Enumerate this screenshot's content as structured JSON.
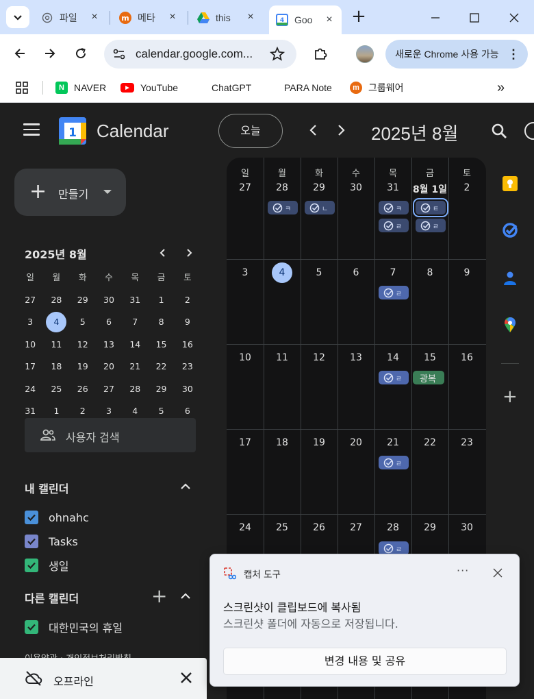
{
  "browser": {
    "tabs": [
      {
        "title": "파일",
        "icon": "chatgpt-icon"
      },
      {
        "title": "메타",
        "icon": "m-app-icon"
      },
      {
        "title": "this",
        "icon": "google-drive-icon"
      },
      {
        "title": "Goo",
        "icon": "google-calendar-icon",
        "active": true
      }
    ],
    "url": "calendar.google.com...",
    "update_label": "새로운 Chrome 사용 가능",
    "bookmarks": [
      {
        "label": "NAVER",
        "color": "#03c75a",
        "glyph": "N"
      },
      {
        "label": "YouTube",
        "color": "#ff0000"
      },
      {
        "label": "ChatGPT"
      },
      {
        "label": "PARA Note"
      },
      {
        "label": "그룹웨어",
        "color": "#e86a10"
      }
    ],
    "overflow": "»"
  },
  "header": {
    "app_title": "Calendar",
    "logo_day": "1",
    "today_label": "오늘",
    "month_title": "2025년 8월"
  },
  "sidebar": {
    "create_label": "만들기",
    "mini_calendar": {
      "title": "2025년 8월",
      "weekdays": [
        "일",
        "월",
        "화",
        "수",
        "목",
        "금",
        "토"
      ],
      "weeks": [
        [
          "27",
          "28",
          "29",
          "30",
          "31",
          "1",
          "2"
        ],
        [
          "3",
          "4",
          "5",
          "6",
          "7",
          "8",
          "9"
        ],
        [
          "10",
          "11",
          "12",
          "13",
          "14",
          "15",
          "16"
        ],
        [
          "17",
          "18",
          "19",
          "20",
          "21",
          "22",
          "23"
        ],
        [
          "24",
          "25",
          "26",
          "27",
          "28",
          "29",
          "30"
        ],
        [
          "31",
          "1",
          "2",
          "3",
          "4",
          "5",
          "6"
        ]
      ],
      "selected": "4"
    },
    "people_search_placeholder": "사용자 검색",
    "my_calendars_title": "내 캘린더",
    "my_calendars": [
      {
        "label": "ohnahc",
        "color": "#4a90d9"
      },
      {
        "label": "Tasks",
        "color": "#7986cb"
      },
      {
        "label": "생일",
        "color": "#33b679"
      }
    ],
    "other_calendars_title": "다른 캘린더",
    "other_calendars": [
      {
        "label": "대한민국의 휴일",
        "color": "#33b679"
      }
    ],
    "footer": "이용약관 · 개인정보처리방침"
  },
  "grid": {
    "weekdays": [
      "일",
      "월",
      "화",
      "수",
      "목",
      "금",
      "토"
    ],
    "first_row_days": [
      "27",
      "28",
      "29",
      "30",
      "31",
      "8월 1일",
      "2"
    ],
    "weeks": [
      [
        "3",
        "4",
        "5",
        "6",
        "7",
        "8",
        "9"
      ],
      [
        "10",
        "11",
        "12",
        "13",
        "14",
        "15",
        "16"
      ],
      [
        "17",
        "18",
        "19",
        "20",
        "21",
        "22",
        "23"
      ],
      [
        "24",
        "25",
        "26",
        "27",
        "28",
        "29",
        "30"
      ]
    ],
    "today": "4",
    "holiday_chip": "광복",
    "task_chip_glyphs": [
      "ㅋ",
      "ㄴ",
      "ㅋ",
      "ㅌ",
      "ㄹ",
      "ㄹ",
      "ㄹ",
      "ㄹ"
    ]
  },
  "offline_bar": {
    "label": "오프라인"
  },
  "toast": {
    "app_name": "캡처 도구",
    "more": "···",
    "title": "스크린샷이 클립보드에 복사됨",
    "body": "스크린샷 폴더에 자동으로 저장됩니다.",
    "action_label": "변경 내용 및 공유"
  },
  "colors": {
    "accent": "#a8c7fa",
    "task_chip": "#4e68ad",
    "holiday_chip": "#3a7d56",
    "tab_strip": "#d3e3fd"
  }
}
